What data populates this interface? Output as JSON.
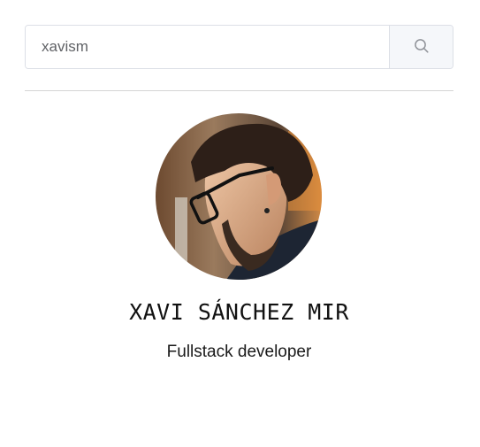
{
  "search": {
    "value": "xavism",
    "button_icon": "search-icon"
  },
  "profile": {
    "avatar_icon": "profile-photo",
    "name": "XAVI SÁNCHEZ MIR",
    "role": "Fullstack developer"
  }
}
